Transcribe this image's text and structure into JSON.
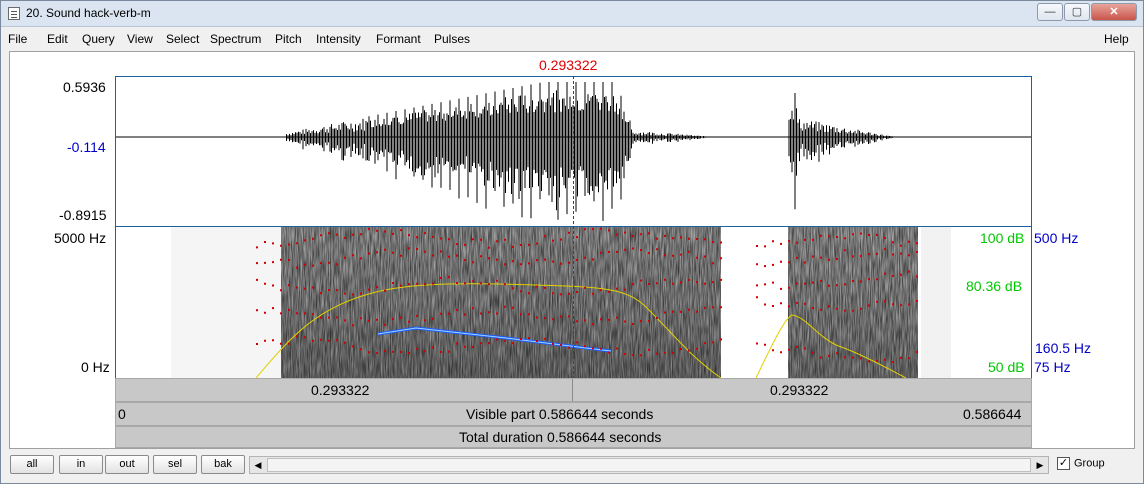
{
  "window": {
    "title": "20. Sound hack-verb-m",
    "minimize_label": "—",
    "maximize_label": "▢",
    "close_label": "✕"
  },
  "menu": [
    "File",
    "Edit",
    "Query",
    "View",
    "Select",
    "Spectrum",
    "Pitch",
    "Intensity",
    "Formant",
    "Pulses",
    "Help"
  ],
  "cursor": {
    "time": "0.293322",
    "fraction": 0.5
  },
  "waveform": {
    "max_label": "0.5936",
    "value_label": "-0.114",
    "min_label": "-0.8915"
  },
  "spectrogram": {
    "top_freq_label": "5000 Hz",
    "bottom_freq_label": "0 Hz",
    "intensity_top_label": "100 dB",
    "intensity_mid_label": "80.36 dB",
    "intensity_bottom_label": "50 dB",
    "pitch_top_label": "500 Hz",
    "pitch_value_label": "160.5 Hz",
    "pitch_bottom_label": "75 Hz"
  },
  "bars": {
    "left_part": "0.293322",
    "right_part": "0.293322",
    "visible_start": "0",
    "visible_caption": "Visible part 0.586644 seconds",
    "visible_end": "0.586644",
    "total_caption": "Total duration 0.586644 seconds"
  },
  "bottom": {
    "buttons": [
      "all",
      "in",
      "out",
      "sel",
      "bak"
    ],
    "scroll_left_arrow": "◀",
    "scroll_right_arrow": "▶",
    "group_label": "Group",
    "group_checked": true,
    "check_mark": "✓"
  },
  "colors": {
    "cursor": "#e00000",
    "pitch_curve": "#1e5bff",
    "formant_dots": "#d00000",
    "intensity_curve": "#e0d000",
    "frame": "#1c5fa3"
  }
}
